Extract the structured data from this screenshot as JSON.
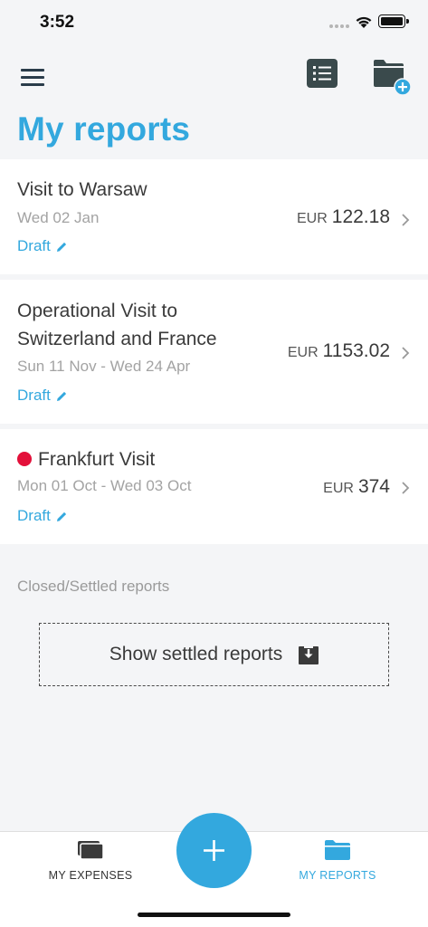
{
  "status_bar": {
    "time": "3:52"
  },
  "header": {
    "title": "My reports"
  },
  "reports": [
    {
      "title": "Visit to Warsaw",
      "dates": "Wed 02 Jan",
      "status": "Draft",
      "currency": "EUR",
      "amount": "122.18",
      "flagged": false
    },
    {
      "title": "Operational Visit to Switzerland and France",
      "title_line1": "Operational Visit to",
      "title_line2": "Switzerland and France",
      "dates": "Sun 11 Nov - Wed 24 Apr",
      "status": "Draft",
      "currency": "EUR",
      "amount": "1153.02",
      "flagged": false
    },
    {
      "title": "Frankfurt Visit",
      "dates": "Mon 01 Oct - Wed 03 Oct",
      "status": "Draft",
      "currency": "EUR",
      "amount": "374",
      "flagged": true
    }
  ],
  "closed_section": {
    "label": "Closed/Settled reports",
    "button_label": "Show settled reports"
  },
  "tab_bar": {
    "tabs": [
      {
        "label": "MY EXPENSES",
        "icon": "expenses-stack-icon",
        "active": false
      },
      {
        "label": "MY REPORTS",
        "icon": "folder-icon",
        "active": true
      }
    ],
    "fab_icon": "plus-icon"
  },
  "colors": {
    "accent": "#33a8de",
    "flag": "#e3103a",
    "background": "#f4f5f7",
    "dark_icon": "#3a4a4c"
  }
}
